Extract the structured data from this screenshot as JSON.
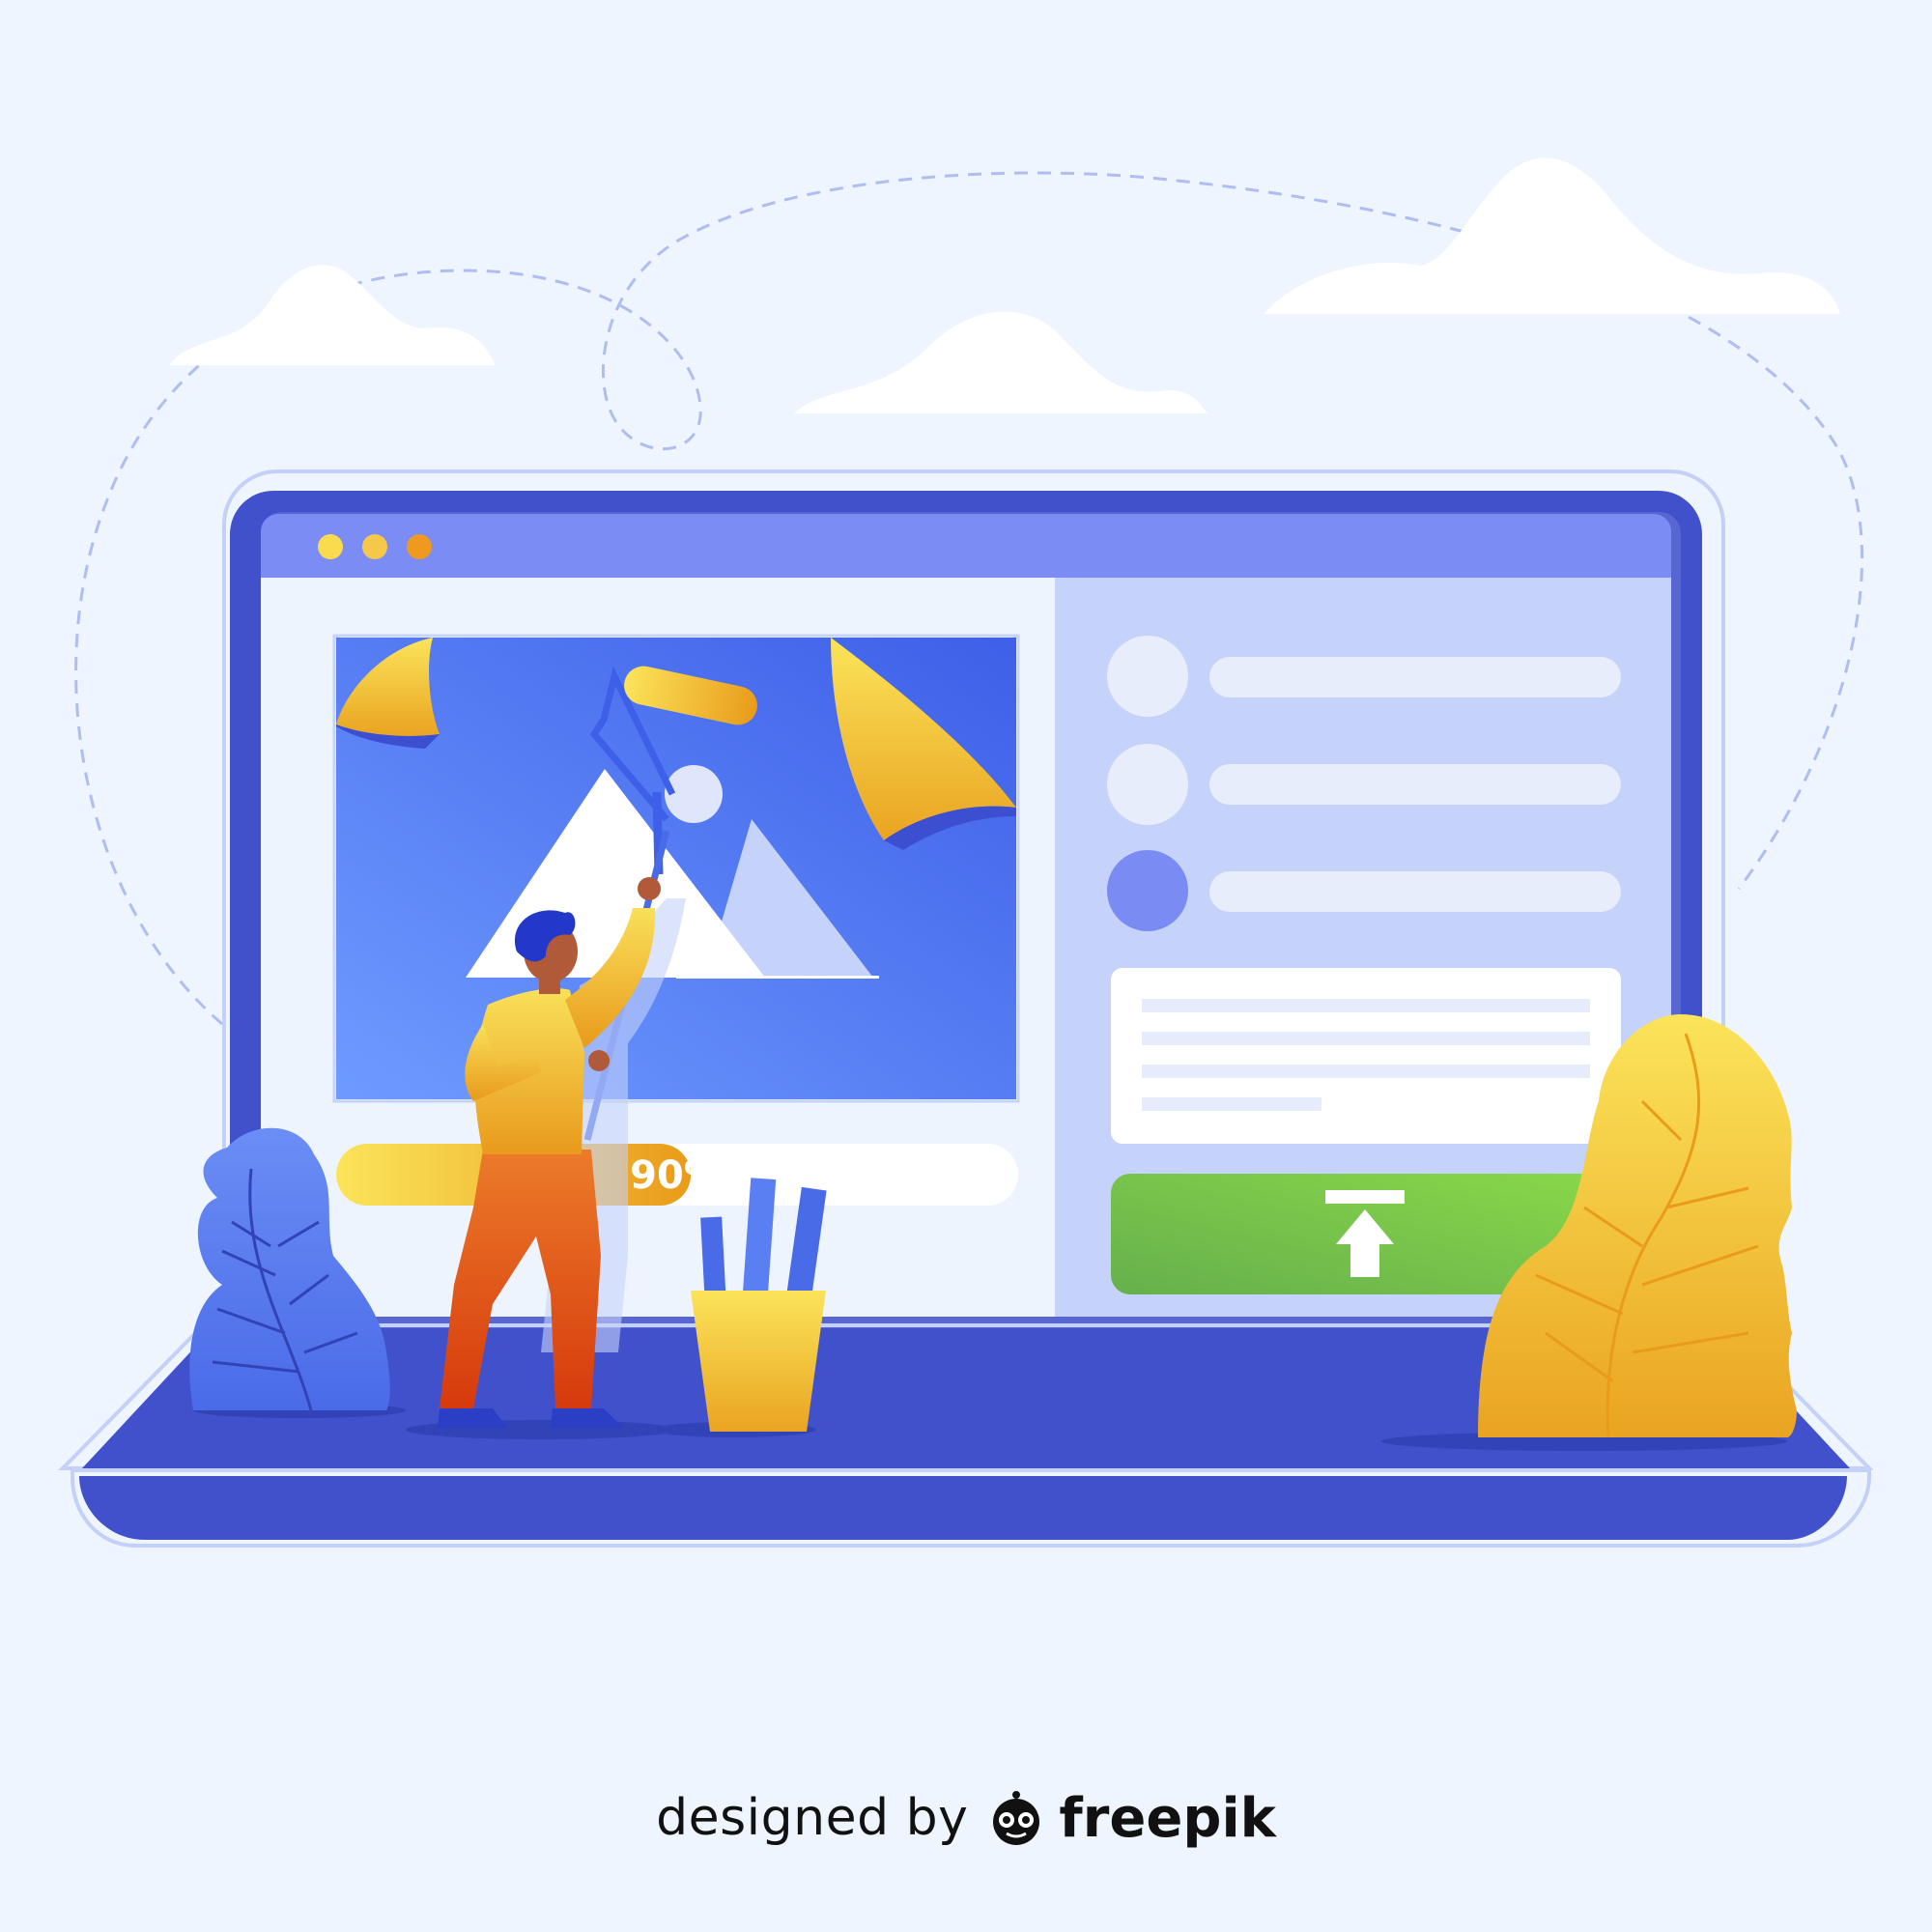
{
  "progress": {
    "label": "90%",
    "value": 0.9
  },
  "window": {
    "dots": [
      {
        "color": "#fbdb4e",
        "name": "window-dot-1"
      },
      {
        "color": "#f6c84a",
        "name": "window-dot-2"
      },
      {
        "color": "#ef9a1e",
        "name": "window-dot-3"
      }
    ]
  },
  "upload": {
    "icon": "upload-arrow-icon",
    "color": "#7ccd4a"
  },
  "list": {
    "radios": [
      {
        "selected": false
      },
      {
        "selected": false
      },
      {
        "selected": true
      }
    ]
  },
  "colors": {
    "background": "#eef5fe",
    "laptop": "#4151cc",
    "titlebar": "#7c8cf5",
    "panel": "#c5d2fa",
    "image": "#5a7ff2",
    "accent_yellow": "#f8d94a",
    "accent_orange": "#e99b1a",
    "green": "#7ccd4a"
  },
  "credit": {
    "prefix": "designed by",
    "brand": "freepik",
    "logo": "freepik-logo-icon"
  }
}
